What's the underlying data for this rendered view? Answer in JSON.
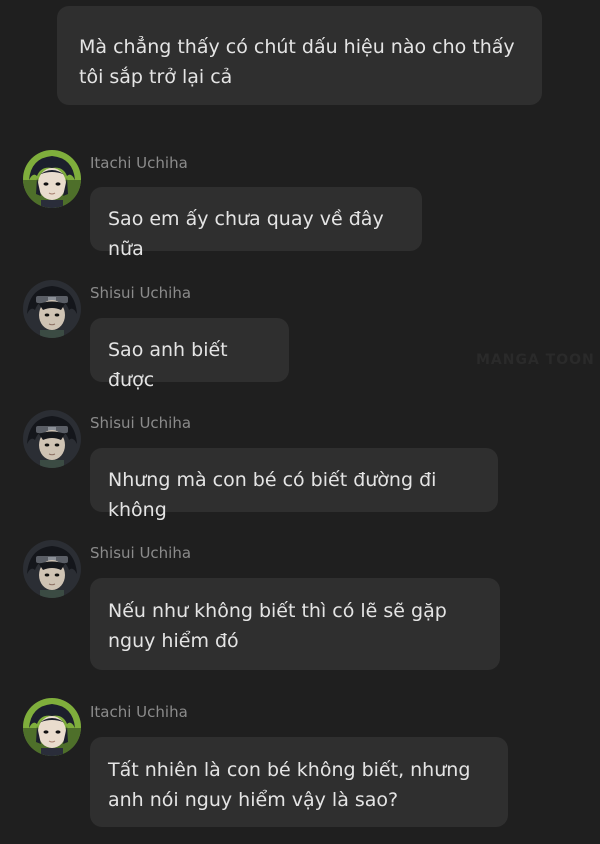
{
  "colors": {
    "background": "#1f1f1f",
    "bubble": "#2f2f2f",
    "bubble_text": "#e4e4e4",
    "sender_name": "#8b8b8b"
  },
  "watermark": "MANGA TOON",
  "messages": [
    {
      "sender": "",
      "avatar_icon": "",
      "text": "Mà chẳng thấy có chút dấu hiệu nào cho thấy tôi sắp trở lại cả"
    },
    {
      "sender": "Itachi Uchiha",
      "avatar_icon": "itachi-avatar-icon",
      "text": "Sao em ấy chưa quay về đây nữa"
    },
    {
      "sender": "Shisui Uchiha",
      "avatar_icon": "shisui-avatar-icon",
      "text": "Sao anh biết được"
    },
    {
      "sender": "Shisui Uchiha",
      "avatar_icon": "shisui-avatar-icon",
      "text": "Nhưng mà con bé có biết đường đi không"
    },
    {
      "sender": "Shisui Uchiha",
      "avatar_icon": "shisui-avatar-icon",
      "text": "Nếu như không biết thì có lẽ sẽ gặp nguy hiểm đó"
    },
    {
      "sender": "Itachi Uchiha",
      "avatar_icon": "itachi-avatar-icon",
      "text": "Tất nhiên là con bé không biết, nhưng anh nói nguy hiểm vậy là sao?"
    }
  ]
}
